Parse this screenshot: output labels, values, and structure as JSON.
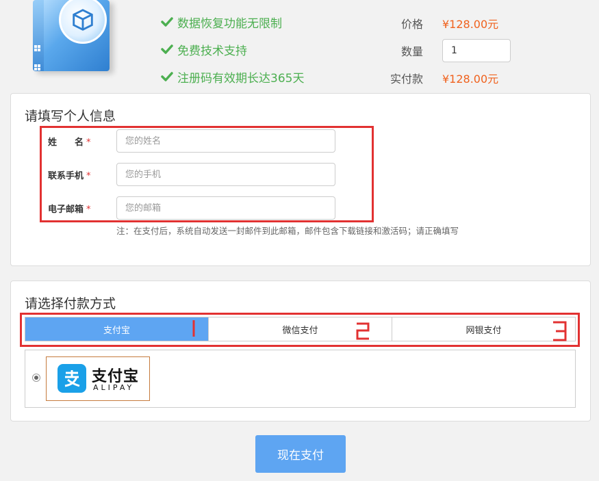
{
  "product": {
    "features": [
      "数据恢复功能无限制",
      "免费技术支持",
      "注册码有效期长达365天"
    ],
    "price_label": "价格",
    "price_value": "¥128.00元",
    "qty_label": "数量",
    "qty_value": "1",
    "total_label": "实付款",
    "total_value": "¥128.00元"
  },
  "info_panel": {
    "title": "请填写个人信息",
    "fields": [
      {
        "label": "姓　　名",
        "placeholder": "您的姓名"
      },
      {
        "label": "联系手机",
        "placeholder": "您的手机"
      },
      {
        "label": "电子邮箱",
        "placeholder": "您的邮箱"
      }
    ],
    "required_mark": "*",
    "note": "注：在支付后，系统自动发送一封邮件到此邮箱，邮件包含下载链接和激活码；请正确填写"
  },
  "pay_panel": {
    "title": "请选择付款方式",
    "tabs": [
      "支付宝",
      "微信支付",
      "网银支付"
    ],
    "active_tab": 0,
    "alipay_name": "支付宝",
    "alipay_sub": "ALIPAY"
  },
  "pay_button": "现在支付",
  "colors": {
    "accent": "#5ea5f2",
    "price": "#f0621e",
    "check": "#4caf50",
    "annotation": "#e23131"
  },
  "icons": {
    "feature": "check-icon",
    "product": "cube-icon",
    "alipay": "alipay-logo-icon"
  }
}
